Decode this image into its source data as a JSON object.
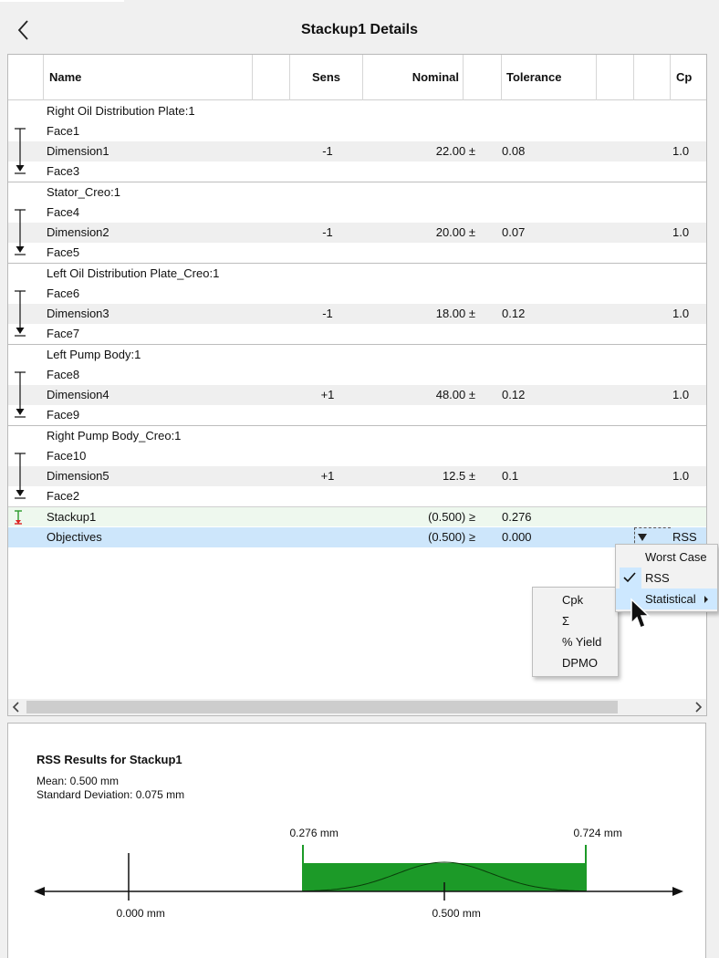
{
  "header": {
    "title": "Stackup1 Details"
  },
  "table": {
    "columns": {
      "name": "Name",
      "sens": "Sens",
      "nominal": "Nominal",
      "tolerance": "Tolerance",
      "cp": "Cp"
    },
    "groups": [
      {
        "part": "Right Oil Distribution Plate:1",
        "face_a": "Face1",
        "dimension": "Dimension1",
        "face_b": "Face3",
        "sens": "-1",
        "nominal": "22.00 ±",
        "tolerance": "0.08",
        "cp": "1.0"
      },
      {
        "part": "Stator_Creo:1",
        "face_a": "Face4",
        "dimension": "Dimension2",
        "face_b": "Face5",
        "sens": "-1",
        "nominal": "20.00 ±",
        "tolerance": "0.07",
        "cp": "1.0"
      },
      {
        "part": "Left Oil Distribution Plate_Creo:1",
        "face_a": "Face6",
        "dimension": "Dimension3",
        "face_b": "Face7",
        "sens": "-1",
        "nominal": "18.00 ±",
        "tolerance": "0.12",
        "cp": "1.0"
      },
      {
        "part": "Left Pump Body:1",
        "face_a": "Face8",
        "dimension": "Dimension4",
        "face_b": "Face9",
        "sens": "+1",
        "nominal": "48.00 ±",
        "tolerance": "0.12",
        "cp": "1.0"
      },
      {
        "part": "Right Pump Body_Creo:1",
        "face_a": "Face10",
        "dimension": "Dimension5",
        "face_b": "Face2",
        "sens": "+1",
        "nominal": "12.5 ±",
        "tolerance": "0.1",
        "cp": "1.0"
      }
    ],
    "stackup": {
      "name": "Stackup1",
      "nominal": "(0.500) ≥",
      "tolerance": "0.276"
    },
    "objectives": {
      "name": "Objectives",
      "nominal": "(0.500) ≥",
      "tolerance": "0.000",
      "method": "RSS"
    }
  },
  "method_menu": {
    "items": [
      {
        "label": "Worst Case"
      },
      {
        "label": "RSS",
        "checked": true
      },
      {
        "label": "Statistical",
        "has_submenu": true
      }
    ]
  },
  "statistical_submenu": {
    "items": [
      "Cpk",
      "Σ",
      "% Yield",
      "DPMO"
    ]
  },
  "results": {
    "title": "RSS Results for Stackup1",
    "mean": "Mean: 0.500 mm",
    "std_dev": "Standard Deviation: 0.075 mm",
    "axis": {
      "min_label": "0.000 mm",
      "mean_label": "0.500 mm",
      "lower_label": "0.276 mm",
      "upper_label": "0.724 mm",
      "zero": 0.0,
      "mean": 0.5,
      "lower": 0.276,
      "upper": 0.724,
      "sigma": 0.075
    },
    "band_color": "#1c9a28"
  }
}
